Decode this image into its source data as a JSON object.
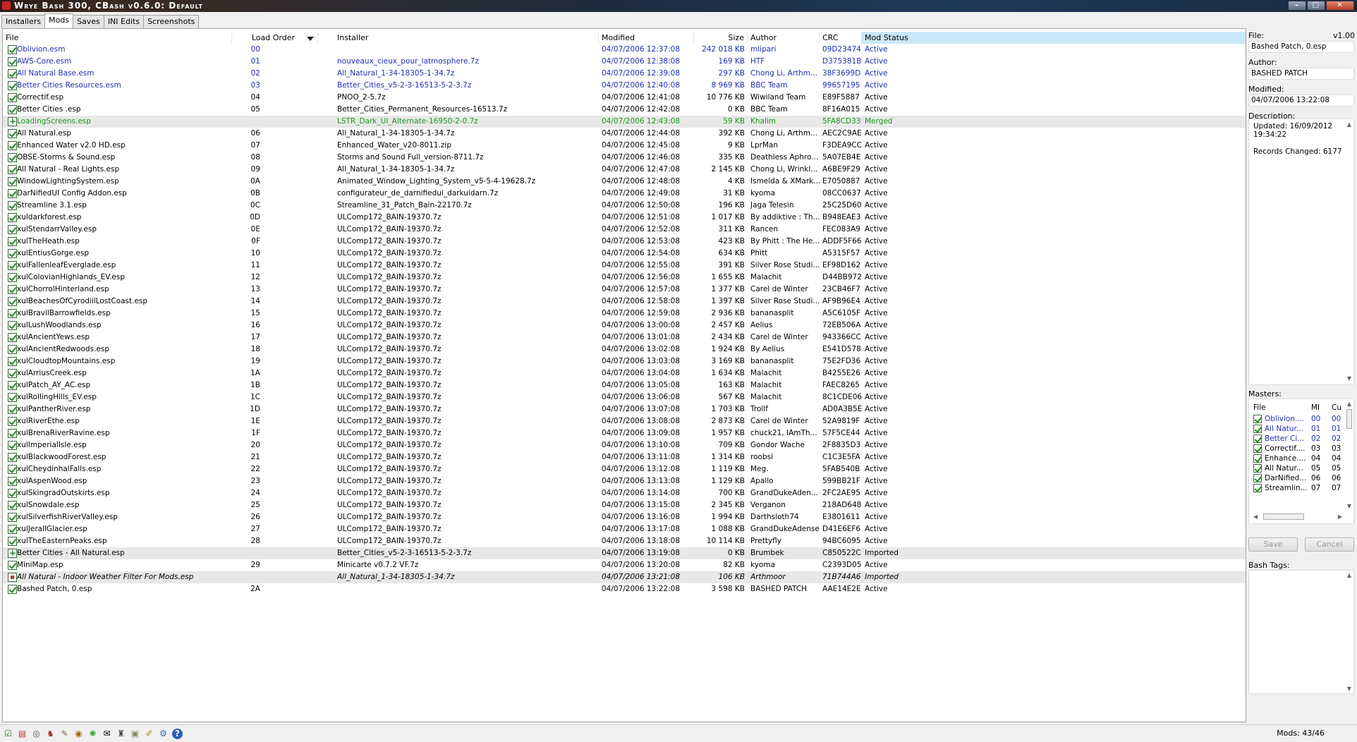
{
  "window": {
    "title": "Wrye Bash 300, CBash v0.6.0: Default"
  },
  "tabs": [
    {
      "label": "Installers",
      "active": false
    },
    {
      "label": "Mods",
      "active": true
    },
    {
      "label": "Saves",
      "active": false
    },
    {
      "label": "INI Edits",
      "active": false
    },
    {
      "label": "Screenshots",
      "active": false
    }
  ],
  "columns": {
    "file": "File",
    "load_order": "Load Order",
    "installer": "Installer",
    "modified": "Modified",
    "size": "Size",
    "author": "Author",
    "crc": "CRC",
    "status": "Mod Status"
  },
  "sort_column": "Mod Status",
  "mods": [
    {
      "state": "checked",
      "color": "blue",
      "file": "Oblivion.esm",
      "order": "00",
      "installer": "",
      "modified": "04/07/2006 12:37:08",
      "size": "242 018 KB",
      "author": "mlipari",
      "crc": "09D23474",
      "status": "Active"
    },
    {
      "state": "checked",
      "color": "blue",
      "file": "AWS-Core.esm",
      "order": "01",
      "installer": "nouveaux_cieux_pour_latmosphere.7z",
      "modified": "04/07/2006 12:38:08",
      "size": "169 KB",
      "author": "HTF",
      "crc": "D375381B",
      "status": "Active"
    },
    {
      "state": "checked",
      "color": "blue",
      "file": "All Natural Base.esm",
      "order": "02",
      "installer": "All_Natural_1-34-18305-1-34.7z",
      "modified": "04/07/2006 12:39:08",
      "size": "297 KB",
      "author": "Chong Li, Arthm...",
      "crc": "38F3699D",
      "status": "Active"
    },
    {
      "state": "checked",
      "color": "blue",
      "file": "Better Cities Resources.esm",
      "order": "03",
      "installer": "Better_Cities_v5-2-3-16513-5-2-3.7z",
      "modified": "04/07/2006 12:40:08",
      "size": "8 969 KB",
      "author": "BBC Team",
      "crc": "99657195",
      "status": "Active"
    },
    {
      "state": "checked",
      "color": "",
      "file": "Correctif.esp",
      "order": "04",
      "installer": "PNOO_2-5.7z",
      "modified": "04/07/2006 12:41:08",
      "size": "10 776 KB",
      "author": "Wiwiland Team",
      "crc": "E89F5887",
      "status": "Active"
    },
    {
      "state": "checked",
      "color": "",
      "file": "Better Cities .esp",
      "order": "05",
      "installer": "Better_Cities_Permanent_Resources-16513.7z",
      "modified": "04/07/2006 12:42:08",
      "size": "0 KB",
      "author": "BBC Team",
      "crc": "8F16A015",
      "status": "Active"
    },
    {
      "state": "plus",
      "color": "green",
      "hl": true,
      "file": "LoadingScreens.esp",
      "order": "",
      "installer": "LSTR_Dark_UI_Alternate-16950-2-0.7z",
      "modified": "04/07/2006 12:43:08",
      "size": "59 KB",
      "author": "Khalim",
      "crc": "5FA8CD33",
      "status": "Merged"
    },
    {
      "state": "checked",
      "color": "",
      "file": "All Natural.esp",
      "order": "06",
      "installer": "All_Natural_1-34-18305-1-34.7z",
      "modified": "04/07/2006 12:44:08",
      "size": "392 KB",
      "author": "Chong Li, Arthm...",
      "crc": "AEC2C9AE",
      "status": "Active"
    },
    {
      "state": "checked",
      "color": "",
      "file": "Enhanced Water v2.0 HD.esp",
      "order": "07",
      "installer": "Enhanced_Water_v20-8011.zip",
      "modified": "04/07/2006 12:45:08",
      "size": "9 KB",
      "author": "LprMan",
      "crc": "F3DEA9CC",
      "status": "Active"
    },
    {
      "state": "checked",
      "color": "",
      "file": "OBSE-Storms & Sound.esp",
      "order": "08",
      "installer": "Storms and Sound Full_version-8711.7z",
      "modified": "04/07/2006 12:46:08",
      "size": "335 KB",
      "author": "Deathless Aphro...",
      "crc": "5A07EB4E",
      "status": "Active"
    },
    {
      "state": "checked",
      "color": "",
      "file": "All Natural - Real Lights.esp",
      "order": "09",
      "installer": "All_Natural_1-34-18305-1-34.7z",
      "modified": "04/07/2006 12:47:08",
      "size": "2 145 KB",
      "author": "Chong Li, Wrinkl...",
      "crc": "A6BE9F29",
      "status": "Active"
    },
    {
      "state": "checked",
      "color": "",
      "file": "WindowLightingSystem.esp",
      "order": "0A",
      "installer": "Animated_Window_Lighting_System_v5-5-4-19628.7z",
      "modified": "04/07/2006 12:48:08",
      "size": "4 KB",
      "author": "Ismelda & XMark...",
      "crc": "E7050887",
      "status": "Active"
    },
    {
      "state": "checked",
      "color": "",
      "file": "DarNifiedUI Config Addon.esp",
      "order": "0B",
      "installer": "configurateur_de_darnifiedui_darkuidarn.7z",
      "modified": "04/07/2006 12:49:08",
      "size": "31 KB",
      "author": "kyoma",
      "crc": "08CC0637",
      "status": "Active"
    },
    {
      "state": "checked",
      "color": "",
      "file": "Streamline 3.1.esp",
      "order": "0C",
      "installer": "Streamline_31_Patch_Bain-22170.7z",
      "modified": "04/07/2006 12:50:08",
      "size": "196 KB",
      "author": "Jaga Telesin",
      "crc": "25C25D60",
      "status": "Active"
    },
    {
      "state": "checked",
      "color": "",
      "file": "xuldarkforest.esp",
      "order": "0D",
      "installer": "ULComp172_BAIN-19370.7z",
      "modified": "04/07/2006 12:51:08",
      "size": "1 017 KB",
      "author": "By addiktive : Th...",
      "crc": "B948EAE3",
      "status": "Active"
    },
    {
      "state": "checked",
      "color": "",
      "file": "xulStendarrValley.esp",
      "order": "0E",
      "installer": "ULComp172_BAIN-19370.7z",
      "modified": "04/07/2006 12:52:08",
      "size": "311 KB",
      "author": "Rancen",
      "crc": "FEC083A9",
      "status": "Active"
    },
    {
      "state": "checked",
      "color": "",
      "file": "xulTheHeath.esp",
      "order": "0F",
      "installer": "ULComp172_BAIN-19370.7z",
      "modified": "04/07/2006 12:53:08",
      "size": "423 KB",
      "author": "By Phitt : The He...",
      "crc": "ADDF5F66",
      "status": "Active"
    },
    {
      "state": "checked",
      "color": "",
      "file": "xulEntiusGorge.esp",
      "order": "10",
      "installer": "ULComp172_BAIN-19370.7z",
      "modified": "04/07/2006 12:54:08",
      "size": "634 KB",
      "author": "Phitt",
      "crc": "A5315F57",
      "status": "Active"
    },
    {
      "state": "checked",
      "color": "",
      "file": "xulFallenleafEverglade.esp",
      "order": "11",
      "installer": "ULComp172_BAIN-19370.7z",
      "modified": "04/07/2006 12:55:08",
      "size": "391 KB",
      "author": "Silver Rose Studi...",
      "crc": "EF98D162",
      "status": "Active"
    },
    {
      "state": "checked",
      "color": "",
      "file": "xulColovianHighlands_EV.esp",
      "order": "12",
      "installer": "ULComp172_BAIN-19370.7z",
      "modified": "04/07/2006 12:56:08",
      "size": "1 655 KB",
      "author": "Malachit",
      "crc": "D44BB972",
      "status": "Active"
    },
    {
      "state": "checked",
      "color": "",
      "file": "xulChorrolHinterland.esp",
      "order": "13",
      "installer": "ULComp172_BAIN-19370.7z",
      "modified": "04/07/2006 12:57:08",
      "size": "1 377 KB",
      "author": "Carel de Winter",
      "crc": "23CB46F7",
      "status": "Active"
    },
    {
      "state": "checked",
      "color": "",
      "file": "xulBeachesOfCyrodiilLostCoast.esp",
      "order": "14",
      "installer": "ULComp172_BAIN-19370.7z",
      "modified": "04/07/2006 12:58:08",
      "size": "1 397 KB",
      "author": "Silver Rose Studi...",
      "crc": "AF9B96E4",
      "status": "Active"
    },
    {
      "state": "checked",
      "color": "",
      "file": "xulBravilBarrowfields.esp",
      "order": "15",
      "installer": "ULComp172_BAIN-19370.7z",
      "modified": "04/07/2006 12:59:08",
      "size": "2 936 KB",
      "author": "bananasplit",
      "crc": "A5C6105F",
      "status": "Active"
    },
    {
      "state": "checked",
      "color": "",
      "file": "xulLushWoodlands.esp",
      "order": "16",
      "installer": "ULComp172_BAIN-19370.7z",
      "modified": "04/07/2006 13:00:08",
      "size": "2 457 KB",
      "author": "Aelius",
      "crc": "72EB506A",
      "status": "Active"
    },
    {
      "state": "checked",
      "color": "",
      "file": "xulAncientYews.esp",
      "order": "17",
      "installer": "ULComp172_BAIN-19370.7z",
      "modified": "04/07/2006 13:01:08",
      "size": "2 434 KB",
      "author": "Carel de Winter",
      "crc": "943366CC",
      "status": "Active"
    },
    {
      "state": "checked",
      "color": "",
      "file": "xulAncientRedwoods.esp",
      "order": "18",
      "installer": "ULComp172_BAIN-19370.7z",
      "modified": "04/07/2006 13:02:08",
      "size": "1 924 KB",
      "author": "By Aelius",
      "crc": "E541D578",
      "status": "Active"
    },
    {
      "state": "checked",
      "color": "",
      "file": "xulCloudtopMountains.esp",
      "order": "19",
      "installer": "ULComp172_BAIN-19370.7z",
      "modified": "04/07/2006 13:03:08",
      "size": "3 169 KB",
      "author": "bananasplit",
      "crc": "75E2FD36",
      "status": "Active"
    },
    {
      "state": "checked",
      "color": "",
      "file": "xulArriusCreek.esp",
      "order": "1A",
      "installer": "ULComp172_BAIN-19370.7z",
      "modified": "04/07/2006 13:04:08",
      "size": "1 634 KB",
      "author": "Malachit",
      "crc": "B4255E26",
      "status": "Active"
    },
    {
      "state": "checked",
      "color": "",
      "file": "xulPatch_AY_AC.esp",
      "order": "1B",
      "installer": "ULComp172_BAIN-19370.7z",
      "modified": "04/07/2006 13:05:08",
      "size": "163 KB",
      "author": "Malachit",
      "crc": "FAEC8265",
      "status": "Active"
    },
    {
      "state": "checked",
      "color": "",
      "file": "xulRollingHills_EV.esp",
      "order": "1C",
      "installer": "ULComp172_BAIN-19370.7z",
      "modified": "04/07/2006 13:06:08",
      "size": "567 KB",
      "author": "Malachit",
      "crc": "8C1CDE06",
      "status": "Active"
    },
    {
      "state": "checked",
      "color": "",
      "file": "xulPantherRiver.esp",
      "order": "1D",
      "installer": "ULComp172_BAIN-19370.7z",
      "modified": "04/07/2006 13:07:08",
      "size": "1 703 KB",
      "author": "Trollf",
      "crc": "AD0A3B5E",
      "status": "Active"
    },
    {
      "state": "checked",
      "color": "",
      "file": "xulRiverEthe.esp",
      "order": "1E",
      "installer": "ULComp172_BAIN-19370.7z",
      "modified": "04/07/2006 13:08:08",
      "size": "2 873 KB",
      "author": "Carel de Winter",
      "crc": "52A9819F",
      "status": "Active"
    },
    {
      "state": "checked",
      "color": "",
      "file": "xulBrenaRiverRavine.esp",
      "order": "1F",
      "installer": "ULComp172_BAIN-19370.7z",
      "modified": "04/07/2006 13:09:08",
      "size": "1 957 KB",
      "author": "chuck21, IAmTh...",
      "crc": "57F5CE44",
      "status": "Active"
    },
    {
      "state": "checked",
      "color": "",
      "file": "xulImperialIsle.esp",
      "order": "20",
      "installer": "ULComp172_BAIN-19370.7z",
      "modified": "04/07/2006 13:10:08",
      "size": "709 KB",
      "author": "Gondor Wache",
      "crc": "2F8835D3",
      "status": "Active"
    },
    {
      "state": "checked",
      "color": "",
      "file": "xulBlackwoodForest.esp",
      "order": "21",
      "installer": "ULComp172_BAIN-19370.7z",
      "modified": "04/07/2006 13:11:08",
      "size": "1 314 KB",
      "author": "roobsi",
      "crc": "C1C3E5FA",
      "status": "Active"
    },
    {
      "state": "checked",
      "color": "",
      "file": "xulCheydinhalFalls.esp",
      "order": "22",
      "installer": "ULComp172_BAIN-19370.7z",
      "modified": "04/07/2006 13:12:08",
      "size": "1 119 KB",
      "author": "Meg.",
      "crc": "5FAB540B",
      "status": "Active"
    },
    {
      "state": "checked",
      "color": "",
      "file": "xulAspenWood.esp",
      "order": "23",
      "installer": "ULComp172_BAIN-19370.7z",
      "modified": "04/07/2006 13:13:08",
      "size": "1 129 KB",
      "author": "Apallo",
      "crc": "599BB21F",
      "status": "Active"
    },
    {
      "state": "checked",
      "color": "",
      "file": "xulSkingradOutskirts.esp",
      "order": "24",
      "installer": "ULComp172_BAIN-19370.7z",
      "modified": "04/07/2006 13:14:08",
      "size": "700 KB",
      "author": "GrandDukeAden...",
      "crc": "2FC2AE95",
      "status": "Active"
    },
    {
      "state": "checked",
      "color": "",
      "file": "xulSnowdale.esp",
      "order": "25",
      "installer": "ULComp172_BAIN-19370.7z",
      "modified": "04/07/2006 13:15:08",
      "size": "2 345 KB",
      "author": "Verganon",
      "crc": "218AD648",
      "status": "Active"
    },
    {
      "state": "checked",
      "color": "",
      "file": "xulSilverfishRiverValley.esp",
      "order": "26",
      "installer": "ULComp172_BAIN-19370.7z",
      "modified": "04/07/2006 13:16:08",
      "size": "1 994 KB",
      "author": "Darthsloth74",
      "crc": "E3801611",
      "status": "Active"
    },
    {
      "state": "checked",
      "color": "",
      "file": "xulJerallGlacier.esp",
      "order": "27",
      "installer": "ULComp172_BAIN-19370.7z",
      "modified": "04/07/2006 13:17:08",
      "size": "1 088 KB",
      "author": "GrandDukeAdense",
      "crc": "D41E6EF6",
      "status": "Active"
    },
    {
      "state": "checked",
      "color": "",
      "file": "xulTheEasternPeaks.esp",
      "order": "28",
      "installer": "ULComp172_BAIN-19370.7z",
      "modified": "04/07/2006 13:18:08",
      "size": "10 114 KB",
      "author": "Prettyfly",
      "crc": "94BC6095",
      "status": "Active"
    },
    {
      "state": "plus",
      "color": "",
      "hl": true,
      "file": "Better Cities - All Natural.esp",
      "order": "",
      "installer": "Better_Cities_v5-2-3-16513-5-2-3.7z",
      "modified": "04/07/2006 13:19:08",
      "size": "0 KB",
      "author": "Brumbek",
      "crc": "C850522C",
      "status": "Imported"
    },
    {
      "state": "checked",
      "color": "",
      "file": "MiniMap.esp",
      "order": "29",
      "installer": "Minicarte v0.7.2 VF.7z",
      "modified": "04/07/2006 13:20:08",
      "size": "82 KB",
      "author": "kyoma",
      "crc": "C2393D05",
      "status": "Active"
    },
    {
      "state": "dot",
      "color": "",
      "hl": true,
      "italic": true,
      "file": "All Natural - Indoor Weather Filter For Mods.esp",
      "order": "",
      "installer": "All_Natural_1-34-18305-1-34.7z",
      "modified": "04/07/2006 13:21:08",
      "size": "106 KB",
      "author": "Arthmoor",
      "crc": "71B744A6",
      "status": "Imported"
    },
    {
      "state": "checked",
      "color": "",
      "file": "Bashed Patch, 0.esp",
      "order": "2A",
      "installer": "",
      "modified": "04/07/2006 13:22:08",
      "size": "3 598 KB",
      "author": "BASHED PATCH",
      "crc": "AAE14E2E",
      "status": "Active"
    }
  ],
  "details": {
    "file_label": "File:",
    "version": "v1.00",
    "file_value": "Bashed Patch, 0.esp",
    "author_label": "Author:",
    "author_value": "BASHED PATCH",
    "modified_label": "Modified:",
    "modified_value": "04/07/2006 13:22:08",
    "description_label": "Description:",
    "description_line1": "Updated: 16/09/2012",
    "description_line2": "19:34:22",
    "description_line3": "Records Changed: 6177",
    "masters_label": "Masters:",
    "masters_cols": {
      "file": "File",
      "mi": "MI",
      "cu": "Cu"
    },
    "masters": [
      {
        "name": "Oblivion....",
        "mi": "00",
        "cu": "00",
        "color": "blue"
      },
      {
        "name": "All Natur...",
        "mi": "01",
        "cu": "01",
        "color": "blue"
      },
      {
        "name": "Better Ci...",
        "mi": "02",
        "cu": "02",
        "color": "blue"
      },
      {
        "name": "Correctif....",
        "mi": "03",
        "cu": "03",
        "color": ""
      },
      {
        "name": "Enhance....",
        "mi": "04",
        "cu": "04",
        "color": ""
      },
      {
        "name": "All Natur...",
        "mi": "05",
        "cu": "05",
        "color": ""
      },
      {
        "name": "DarNified...",
        "mi": "06",
        "cu": "06",
        "color": ""
      },
      {
        "name": "Streamlin...",
        "mi": "07",
        "cu": "07",
        "color": ""
      }
    ],
    "save_label": "Save",
    "cancel_label": "Cancel",
    "bash_tags_label": "Bash Tags:"
  },
  "statusbar": {
    "mods_count": "Mods: 43/46",
    "icons": [
      "check-all-icon",
      "ini-icon",
      "oblivion-icon",
      "boss-icon",
      "tes4edit-icon",
      "gimp-icon",
      "blender-icon",
      "obse-icon",
      "tes4files-icon",
      "dds-icon",
      "notepad-icon",
      "settings-icon",
      "help-icon"
    ]
  }
}
